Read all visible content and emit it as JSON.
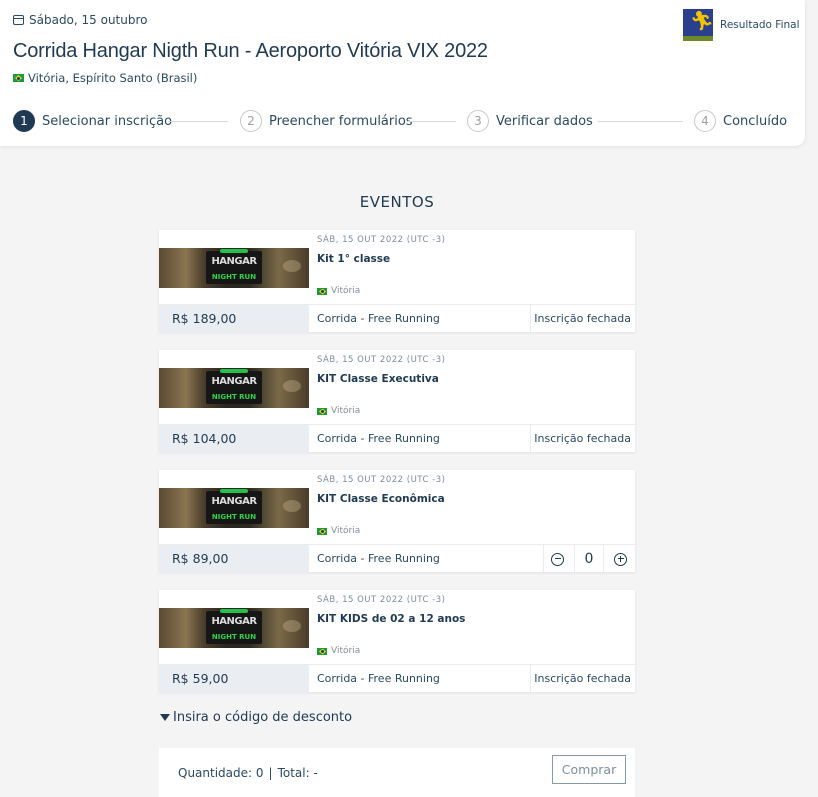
{
  "header": {
    "date": "Sábado, 15 outubro",
    "title": "Corrida Hangar Nigth Run - Aeroporto Vitória VIX 2022",
    "location": "Vitória, Espírito Santo (Brasil)",
    "result_link": "Resultado Final"
  },
  "steps": [
    {
      "num": "1",
      "label": "Selecionar inscrição",
      "active": true
    },
    {
      "num": "2",
      "label": "Preencher formulários",
      "active": false
    },
    {
      "num": "3",
      "label": "Verificar dados",
      "active": false
    },
    {
      "num": "4",
      "label": "Concluído",
      "active": false
    }
  ],
  "section_title": "EVENTOS",
  "thumb_text": {
    "hangar": "HANGAR",
    "night": "NIGHT RUN"
  },
  "tickets": [
    {
      "date": "SÁB, 15 OUT 2022 (UTC -3)",
      "name": "Kit 1° classe",
      "location": "Vitória",
      "price": "R$ 189,00",
      "category": "Corrida - Free Running",
      "status": "Inscrição fechada"
    },
    {
      "date": "SÁB, 15 OUT 2022 (UTC -3)",
      "name": "KIT Classe Executiva",
      "location": "Vitória",
      "price": "R$ 104,00",
      "category": "Corrida - Free Running",
      "status": "Inscrição fechada"
    },
    {
      "date": "SÁB, 15 OUT 2022 (UTC -3)",
      "name": "KIT Classe Econômica",
      "location": "Vitória",
      "price": "R$ 89,00",
      "category": "Corrida - Free Running",
      "quantity": "0"
    },
    {
      "date": "SÁB, 15 OUT 2022 (UTC -3)",
      "name": "KIT KIDS de 02 a 12 anos",
      "location": "Vitória",
      "price": "R$ 59,00",
      "category": "Corrida - Free Running",
      "status": "Inscrição fechada"
    }
  ],
  "discount_label": "Insira o código de desconto",
  "summary": {
    "quantity": "Quantidade: 0",
    "separator": "|",
    "total": "Total: -",
    "buy_label": "Comprar"
  },
  "icons": {
    "calendar": "calendar-icon",
    "flag": "brazil-flag-icon",
    "minus": "minus-circle-icon",
    "plus": "plus-circle-icon",
    "caret": "caret-down-icon"
  }
}
